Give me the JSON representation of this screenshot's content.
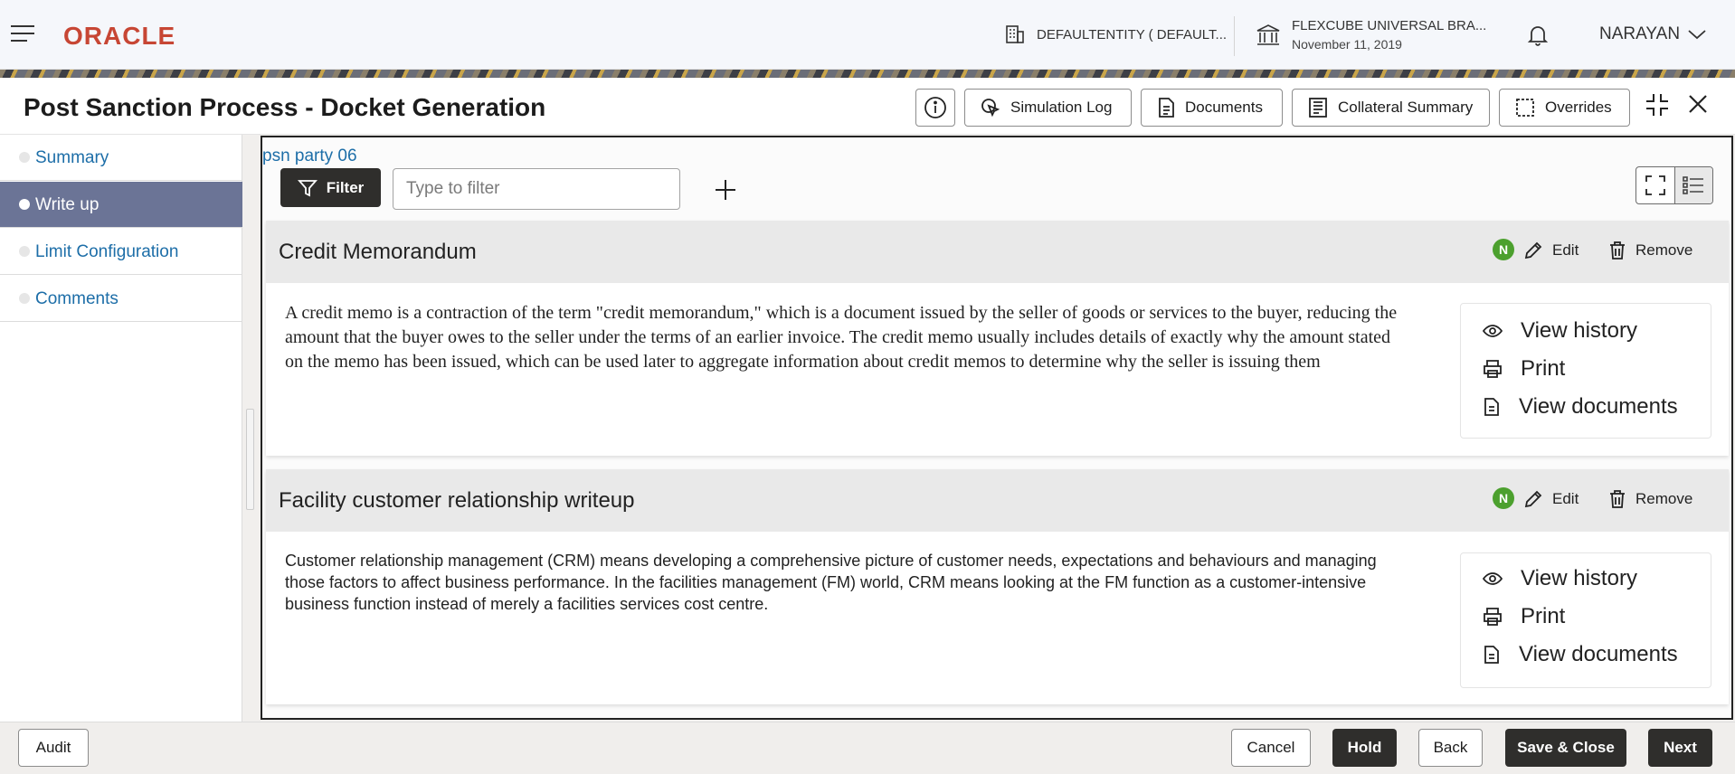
{
  "header": {
    "logo": "ORACLE",
    "entity": "DEFAULTENTITY ( DEFAULT...",
    "branch_name": "FLEXCUBE UNIVERSAL BRA...",
    "branch_date": "November 11, 2019",
    "user": "NARAYAN"
  },
  "titlebar": {
    "title": "Post Sanction Process - Docket Generation",
    "simulation_log": "Simulation Log",
    "documents": "Documents",
    "collateral_summary": "Collateral Summary",
    "overrides": "Overrides"
  },
  "sidebar": {
    "items": [
      {
        "label": "Summary",
        "active": false
      },
      {
        "label": "Write up",
        "active": true
      },
      {
        "label": "Limit Configuration",
        "active": false
      },
      {
        "label": "Comments",
        "active": false
      }
    ]
  },
  "main": {
    "party": "psn party 06",
    "filter_label": "Filter",
    "filter_placeholder": "Type to filter",
    "cards": [
      {
        "title": "Credit Memorandum",
        "badge": "N",
        "edit": "Edit",
        "remove": "Remove",
        "text": "A credit memo is a contraction of the term \"credit memorandum,\" which is a document issued by the seller of goods or services to the buyer, reducing the amount that the buyer owes to the seller under the terms of an earlier invoice. The credit memo usually includes details of exactly why the amount stated on the memo has been issued, which can be used later to aggregate information about credit memos to determine why the seller is issuing them",
        "actions": [
          "View history",
          "Print",
          "View documents"
        ]
      },
      {
        "title": "Facility customer relationship writeup",
        "badge": "N",
        "edit": "Edit",
        "remove": "Remove",
        "text": "Customer relationship management (CRM) means developing a comprehensive picture of customer needs, expectations and behaviours and managing those factors to affect business performance. In the facilities management (FM) world, CRM means looking at the FM function as a customer-intensive business function instead of merely a facilities services cost centre.",
        "actions": [
          "View history",
          "Print",
          "View documents"
        ]
      }
    ]
  },
  "footer": {
    "audit": "Audit",
    "cancel": "Cancel",
    "hold": "Hold",
    "back": "Back",
    "save_close": "Save & Close",
    "next": "Next"
  },
  "colors": {
    "brand_red": "#c74634",
    "active_nav": "#6b7496",
    "link_blue": "#1d6ea8",
    "badge_green": "#4ca02e",
    "dark_button": "#2f2e2c"
  }
}
